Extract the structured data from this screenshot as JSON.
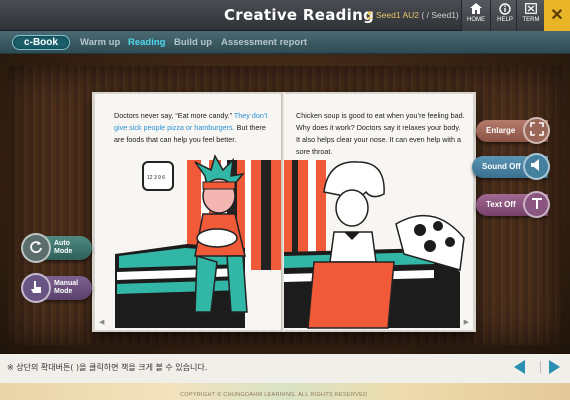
{
  "header": {
    "title": "Creative Reading",
    "user_name": "Seed1",
    "user_level": "AU2",
    "user_path": "( / Seed1)",
    "buttons": [
      {
        "label": "HOME",
        "icon": "home-icon"
      },
      {
        "label": "HELP",
        "icon": "help-icon"
      },
      {
        "label": "TERM",
        "icon": "term-icon"
      }
    ],
    "close_glyph": "✕"
  },
  "nav": {
    "brand": "c-Book",
    "tabs": [
      {
        "label": "Warm up",
        "active": false
      },
      {
        "label": "Reading",
        "active": true
      },
      {
        "label": "Build up",
        "active": false
      },
      {
        "label": "Assessment report",
        "active": false
      }
    ]
  },
  "book": {
    "left_page": {
      "text_before": "Doctors never say, “Eat more candy.” ",
      "text_blue": "They don’t give sick people pizza or hamburgers.",
      "text_after": " But there are foods that can help you feel better."
    },
    "right_page": {
      "text": "Chicken soup is good to eat when you’re feeling bad. Why does it work? Doctors say it relaxes your body. It also helps clear your nose. It can even help with a sore throat."
    },
    "clock_text": "12 3 9 6"
  },
  "side_controls": {
    "enlarge": "Enlarge",
    "sound": "Sound Off",
    "text": "Text Off"
  },
  "mode_controls": {
    "auto": "Auto Mode",
    "manual": "Manual Mode"
  },
  "footer": {
    "hint": "※ 상단의 확대버튼(  )을 클릭하면 책을 크게 볼 수 있습니다.",
    "copyright": "COPYRIGHT © CHUNGDAHM LEARNING. ALL RIGHTS RESERVED"
  },
  "colors": {
    "accent": "#4fd7ee",
    "close": "#e9b426",
    "enlarge": "#a0675a",
    "sound": "#4a7f9e",
    "text": "#8b4f78",
    "auto": "#3f6f6a",
    "manual": "#6d4f7c"
  }
}
